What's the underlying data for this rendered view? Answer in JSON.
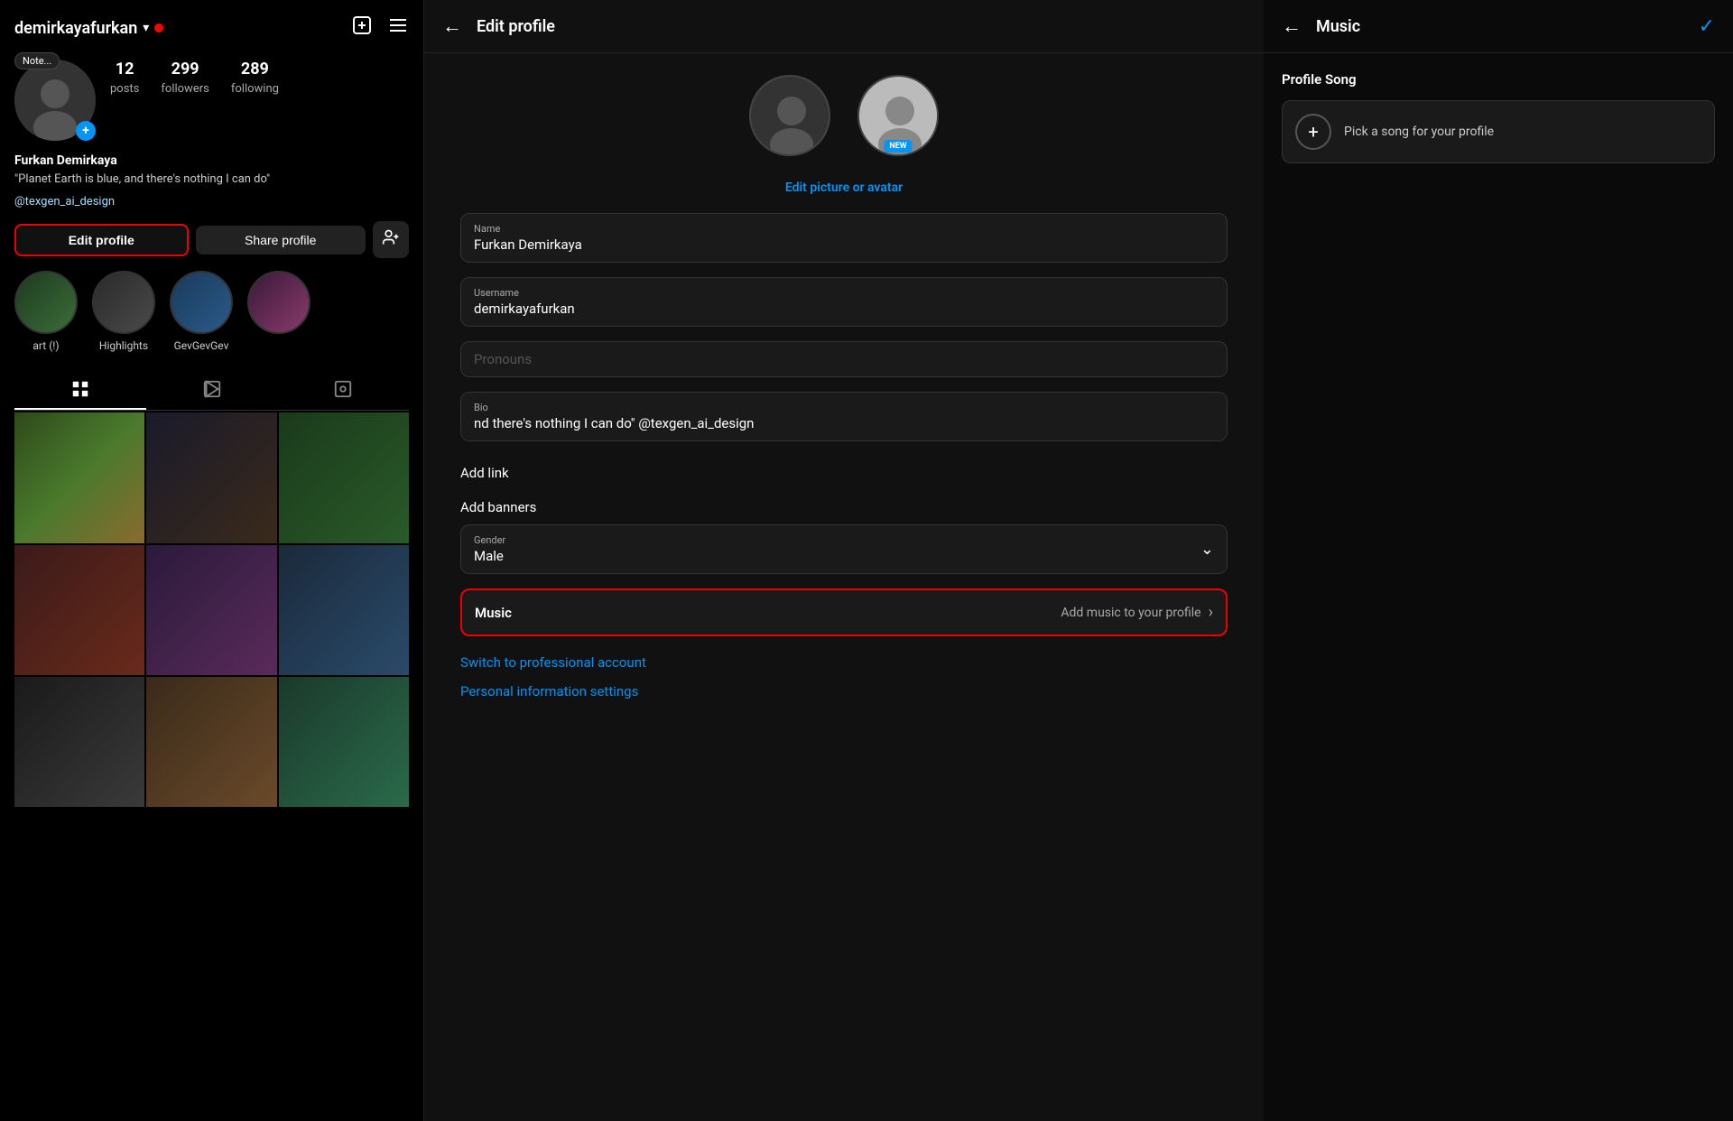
{
  "leftPanel": {
    "username": "demirkayafurkan",
    "onlineDot": true,
    "noteBadge": "Note...",
    "stats": {
      "posts": {
        "number": "12",
        "label": "posts"
      },
      "followers": {
        "number": "299",
        "label": "followers"
      },
      "following": {
        "number": "289",
        "label": "following"
      }
    },
    "profileName": "Furkan Demirkaya",
    "bio": "\"Planet Earth is blue, and there's nothing I can do\"",
    "link": "@texgen_ai_design",
    "buttons": {
      "editProfile": "Edit profile",
      "shareProfile": "Share profile"
    },
    "highlights": [
      {
        "id": "art",
        "label": "art (!)"
      },
      {
        "id": "highlights",
        "label": "Highlights"
      },
      {
        "id": "gevgev",
        "label": "GevGevGev"
      },
      {
        "id": "anime",
        "label": ""
      }
    ]
  },
  "middlePanel": {
    "title": "Edit profile",
    "editPictureLink": "Edit picture or avatar",
    "fields": {
      "nameLabel": "Name",
      "nameValue": "Furkan Demirkaya",
      "usernameLabel": "Username",
      "usernameValue": "demirkayafurkan",
      "pronounsPlaceholder": "Pronouns",
      "bioLabel": "Bio",
      "bioValue": "nd there's nothing I can do\" @texgen_ai_design",
      "addLink": "Add link",
      "addBanners": "Add banners",
      "genderLabel": "Gender",
      "genderValue": "Male",
      "musicLabel": "Music",
      "musicSubtext": "Add music to your profile",
      "switchToProLink": "Switch to professional account",
      "personalInfoLink": "Personal information settings"
    }
  },
  "rightPanel": {
    "title": "Music",
    "profileSong": {
      "sectionTitle": "Profile Song",
      "pickText": "Pick a song for your profile"
    }
  }
}
